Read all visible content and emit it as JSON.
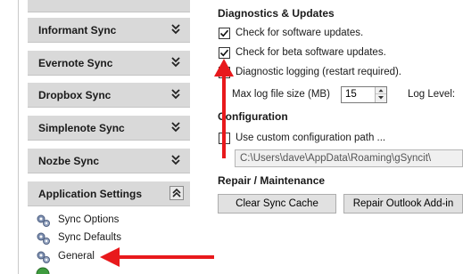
{
  "nav": {
    "groups": [
      {
        "label": "Informant Sync"
      },
      {
        "label": "Evernote Sync"
      },
      {
        "label": "Dropbox Sync"
      },
      {
        "label": "Simplenote Sync"
      },
      {
        "label": "Nozbe Sync"
      },
      {
        "label": "Application Settings"
      }
    ],
    "items": [
      {
        "label": "Sync Options",
        "icon": "gears-icon"
      },
      {
        "label": "Sync Defaults",
        "icon": "gears-icon"
      },
      {
        "label": "General",
        "icon": "gears-icon"
      }
    ]
  },
  "diagnostics": {
    "title": "Diagnostics & Updates",
    "check_updates": {
      "label": "Check for software updates.",
      "checked": true
    },
    "check_beta": {
      "label": "Check for beta software updates.",
      "checked": true
    },
    "diag_logging": {
      "label": "Diagnostic logging (restart required).",
      "checked": false
    },
    "max_log_label": "Max log file size (MB)",
    "max_log_value": "15",
    "log_level_label": "Log Level:"
  },
  "configuration": {
    "title": "Configuration",
    "custom_path": {
      "label": "Use custom configuration path ...",
      "checked": false
    },
    "path_value": "C:\\Users\\dave\\AppData\\Roaming\\gSyncit\\"
  },
  "repair": {
    "title": "Repair / Maintenance",
    "clear_cache_label": "Clear Sync Cache",
    "repair_addin_label": "Repair Outlook Add-in"
  },
  "colors": {
    "annotation_red": "#e8191c",
    "group_header_bg": "#d9d9d9",
    "button_bg": "#e1e1e1"
  }
}
